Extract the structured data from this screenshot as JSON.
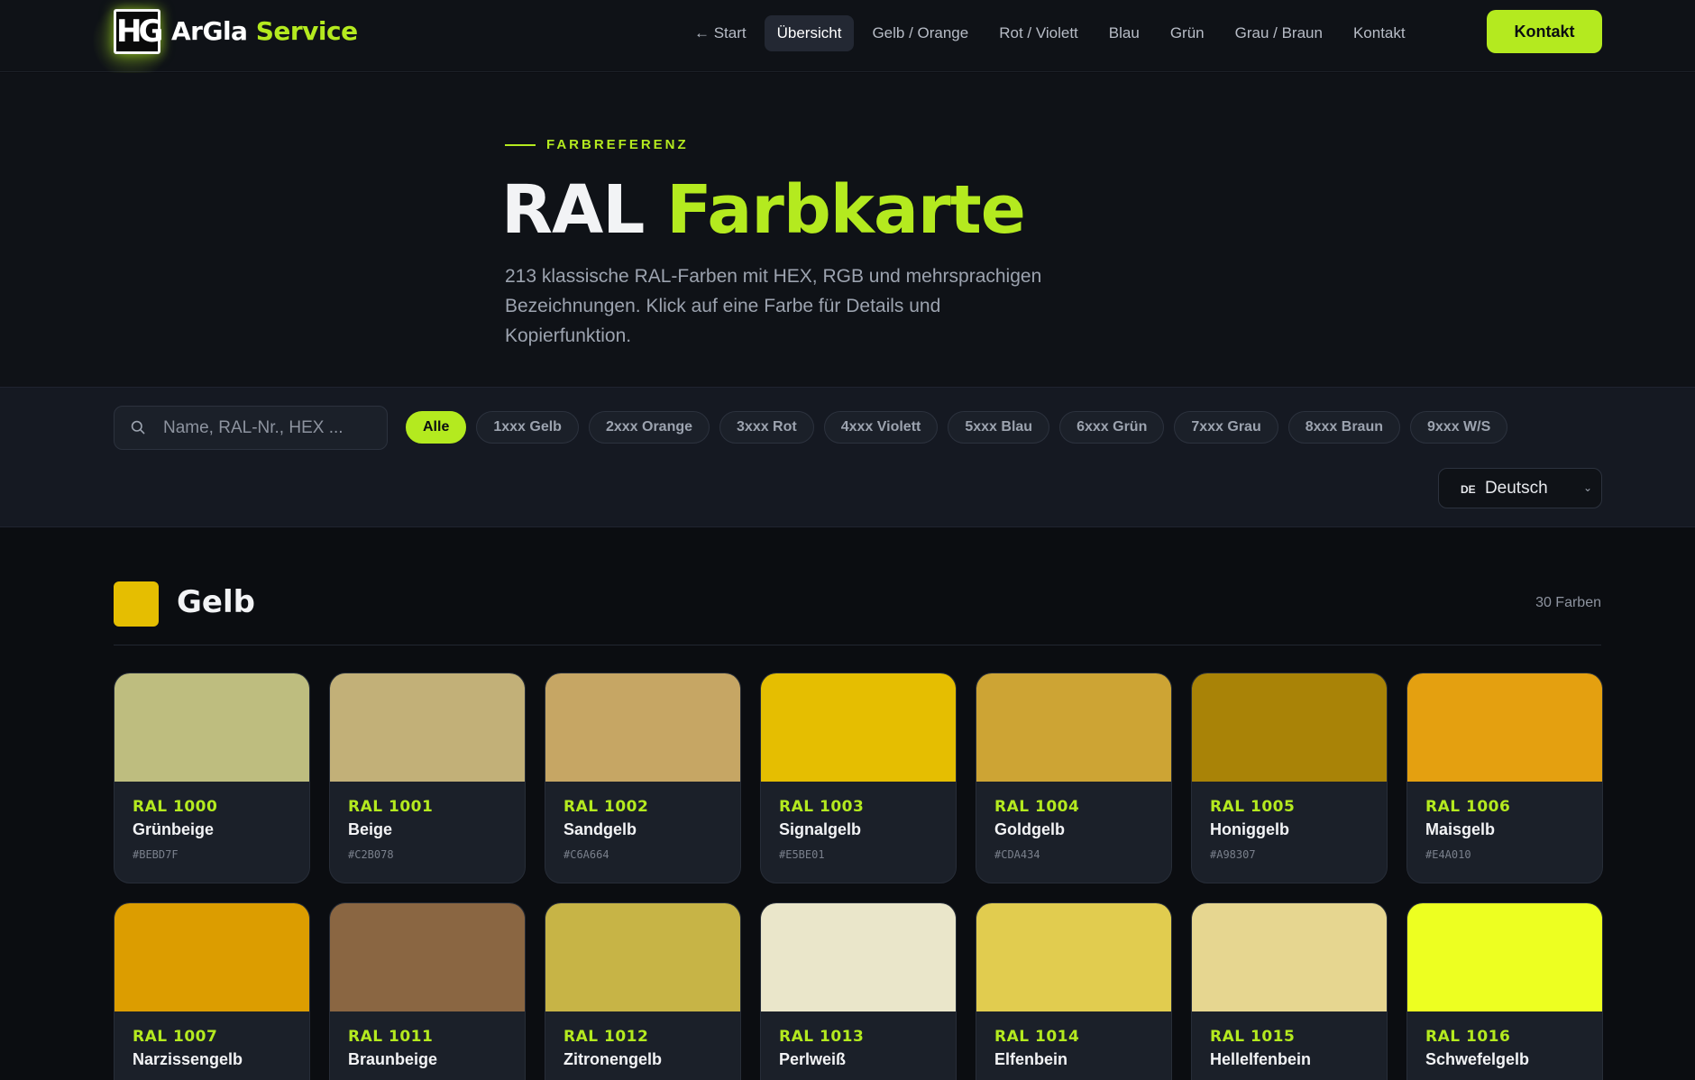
{
  "header": {
    "logo_mark": "HG",
    "brand_part1": "ArGla",
    "brand_part2": "Service",
    "nav": [
      {
        "label": "← Start",
        "active": false
      },
      {
        "label": "Übersicht",
        "active": true
      },
      {
        "label": "Gelb / Orange",
        "active": false
      },
      {
        "label": "Rot / Violett",
        "active": false
      },
      {
        "label": "Blau",
        "active": false
      },
      {
        "label": "Grün",
        "active": false
      },
      {
        "label": "Grau / Braun",
        "active": false
      },
      {
        "label": "Kontakt",
        "active": false
      }
    ],
    "cta_label": "Kontakt"
  },
  "hero": {
    "eyebrow": "FARBREFERENZ",
    "title_part1": "RAL",
    "title_part2": "Farbkarte",
    "subtitle": "213 klassische RAL-Farben mit HEX, RGB und mehrsprachigen Bezeichnungen. Klick auf eine Farbe für Details und Kopierfunktion."
  },
  "filters": {
    "search_placeholder": "Name, RAL-Nr., HEX ...",
    "chips": [
      {
        "label": "Alle",
        "active": true
      },
      {
        "label": "1xxx Gelb",
        "active": false
      },
      {
        "label": "2xxx Orange",
        "active": false
      },
      {
        "label": "3xxx Rot",
        "active": false
      },
      {
        "label": "4xxx Violett",
        "active": false
      },
      {
        "label": "5xxx Blau",
        "active": false
      },
      {
        "label": "6xxx Grün",
        "active": false
      },
      {
        "label": "7xxx Grau",
        "active": false
      },
      {
        "label": "8xxx Braun",
        "active": false
      },
      {
        "label": "9xxx W/S",
        "active": false
      }
    ],
    "language_flag": "DE",
    "language": "Deutsch"
  },
  "section": {
    "title": "Gelb",
    "count": "30 Farben",
    "swatch_color": "#E5BE01"
  },
  "colors": [
    {
      "code": "RAL 1000",
      "name": "Grünbeige",
      "hex": "#BEBD7F",
      "color": "#BEBD7F"
    },
    {
      "code": "RAL 1001",
      "name": "Beige",
      "hex": "#C2B078",
      "color": "#C2B078"
    },
    {
      "code": "RAL 1002",
      "name": "Sandgelb",
      "hex": "#C6A664",
      "color": "#C6A664"
    },
    {
      "code": "RAL 1003",
      "name": "Signalgelb",
      "hex": "#E5BE01",
      "color": "#E5BE01"
    },
    {
      "code": "RAL 1004",
      "name": "Goldgelb",
      "hex": "#CDA434",
      "color": "#CDA434"
    },
    {
      "code": "RAL 1005",
      "name": "Honiggelb",
      "hex": "#A98307",
      "color": "#A98307"
    },
    {
      "code": "RAL 1006",
      "name": "Maisgelb",
      "hex": "#E4A010",
      "color": "#E4A010"
    },
    {
      "code": "RAL 1007",
      "name": "Narzissengelb",
      "hex": "",
      "color": "#DC9D00"
    },
    {
      "code": "RAL 1011",
      "name": "Braunbeige",
      "hex": "",
      "color": "#8A6642"
    },
    {
      "code": "RAL 1012",
      "name": "Zitronengelb",
      "hex": "",
      "color": "#C7B446"
    },
    {
      "code": "RAL 1013",
      "name": "Perlweiß",
      "hex": "",
      "color": "#EAE6CA"
    },
    {
      "code": "RAL 1014",
      "name": "Elfenbein",
      "hex": "",
      "color": "#E1CC4F"
    },
    {
      "code": "RAL 1015",
      "name": "Hellelfenbein",
      "hex": "",
      "color": "#E6D690"
    },
    {
      "code": "RAL 1016",
      "name": "Schwefelgelb",
      "hex": "",
      "color": "#EDFF21"
    }
  ],
  "accent_color": "#B4EA1F"
}
